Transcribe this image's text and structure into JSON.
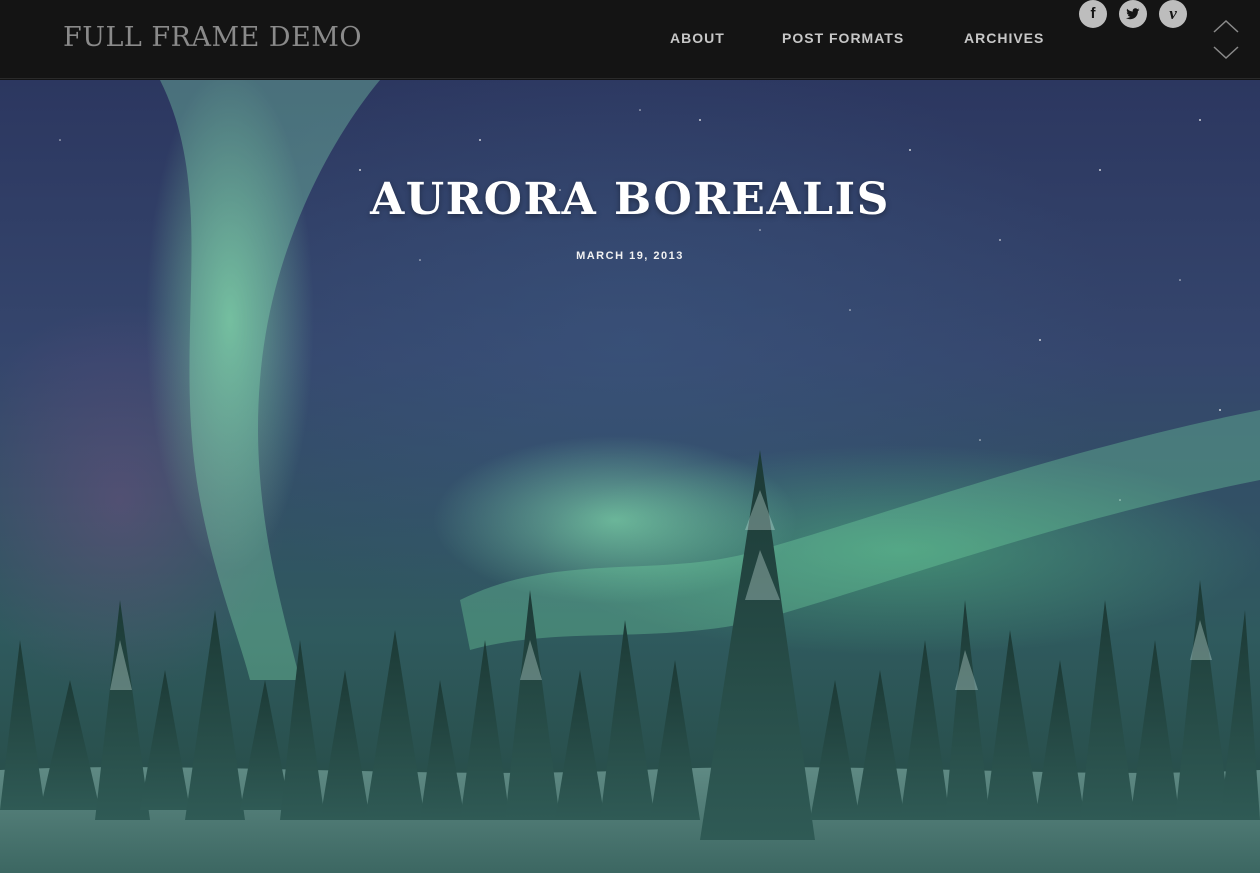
{
  "site": {
    "title": "FULL FRAME DEMO"
  },
  "nav": {
    "items": [
      {
        "label": "ABOUT"
      },
      {
        "label": "POST FORMATS"
      },
      {
        "label": "ARCHIVES"
      }
    ]
  },
  "social": [
    {
      "icon": "facebook-icon",
      "glyph": "f"
    },
    {
      "icon": "twitter-icon",
      "glyph": ""
    },
    {
      "icon": "vimeo-icon",
      "glyph": "v"
    }
  ],
  "post": {
    "title": "AURORA BOREALIS",
    "date": "MARCH 19, 2013"
  },
  "colors": {
    "header_bg": "#141414",
    "title_gray": "#8a8a8a",
    "nav_text": "#c7c7c7",
    "social_bg": "#bdbdbd",
    "hero_title": "#ffffff"
  }
}
